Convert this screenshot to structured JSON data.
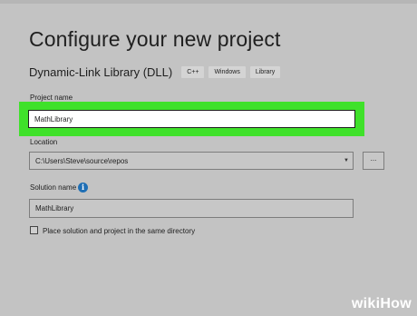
{
  "dialog": {
    "title": "Configure your new project",
    "template_name": "Dynamic-Link Library (DLL)",
    "tags": [
      "C++",
      "Windows",
      "Library"
    ]
  },
  "project_name": {
    "label": "Project name",
    "value": "MathLibrary",
    "highlight_color": "#3fe12a"
  },
  "location": {
    "label": "Location",
    "value": "C:\\Users\\Steve\\source\\repos",
    "browse_label": "..."
  },
  "solution_name": {
    "label": "Solution name",
    "value": "MathLibrary"
  },
  "same_directory": {
    "label": "Place solution and project in the same directory",
    "checked": false
  },
  "watermark": {
    "text": "wikiHow"
  },
  "icons": {
    "info": "info-icon",
    "dropdown": "chevron-down-icon"
  }
}
